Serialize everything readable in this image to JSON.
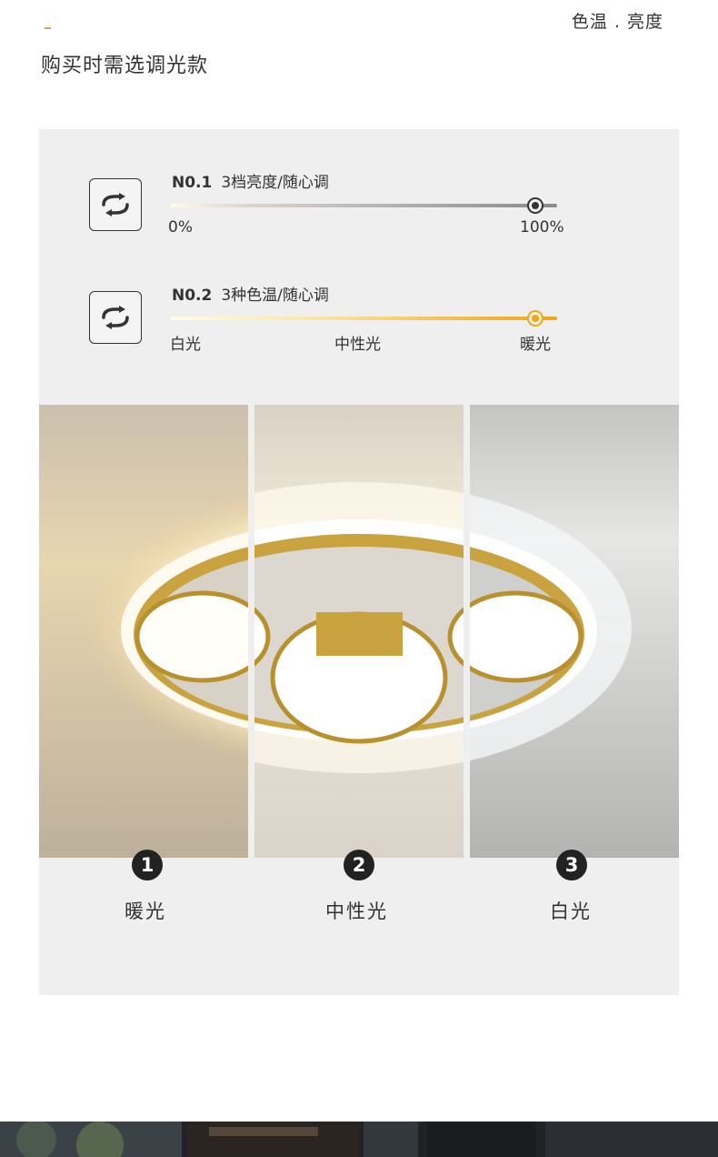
{
  "header": {
    "top_right": "色温 . 亮度",
    "title": "购买时需选调光款"
  },
  "controls": [
    {
      "no": "N0.1",
      "desc": "3档亮度/随心调",
      "ticks": [
        "0%",
        "100%"
      ],
      "level": 1.0,
      "icon": "swap-arrows-icon"
    },
    {
      "no": "N0.2",
      "desc": "3种色温/随心调",
      "ticks": [
        "白光",
        "中性光",
        "暖光"
      ],
      "level": 1.0,
      "icon": "swap-arrows-icon"
    }
  ],
  "panels": [
    {
      "number": "1",
      "label": "暖光"
    },
    {
      "number": "2",
      "label": "中性光"
    },
    {
      "number": "3",
      "label": "白光"
    }
  ],
  "colors": {
    "accent": "#d9a25a",
    "gold": "#c9a340",
    "warm_slider": "#f0a51c",
    "panel_bg": "#efefef"
  }
}
